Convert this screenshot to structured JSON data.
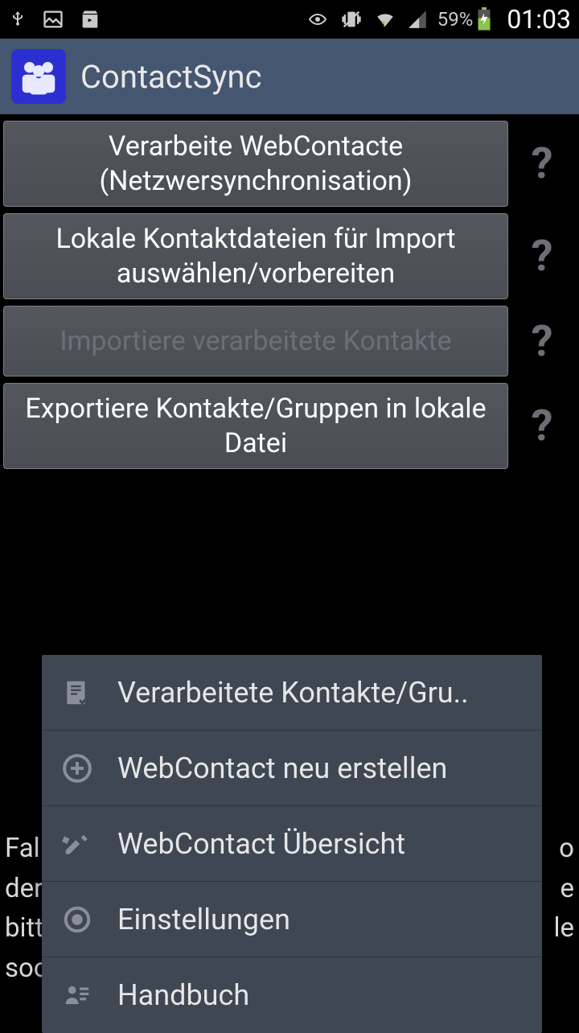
{
  "status": {
    "battery_text": "59%",
    "time": "01:03"
  },
  "app": {
    "title": "ContactSync"
  },
  "buttons": {
    "b1": "Verarbeite WebContacte (Netzwersynchronisation)",
    "b2": "Lokale Kontaktdateien für Import auswählen/vorbereiten",
    "b3": "Importiere verarbeitete Kontakte",
    "b4": "Exportiere Kontakte/Gruppen in lokale Datei",
    "help": "?"
  },
  "bgtext": {
    "l1": "Fal",
    "l2": "der",
    "l3": "bitt",
    "l4": "soc",
    "r1": "o",
    "r2": "e",
    "r3": "le"
  },
  "menu": {
    "i1": "Verarbeitete Kontakte/Gru..",
    "i2": "WebContact neu erstellen",
    "i3": "WebContact Übersicht",
    "i4": "Einstellungen",
    "i5": "Handbuch"
  }
}
